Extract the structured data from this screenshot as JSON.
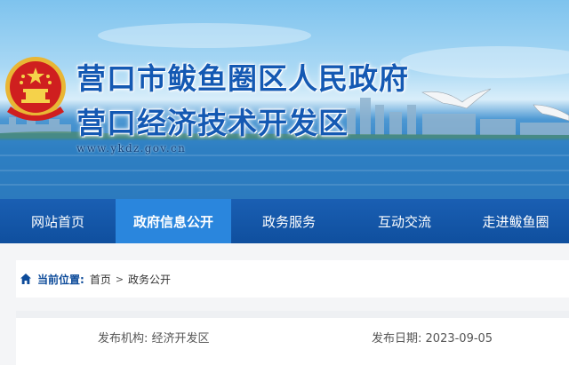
{
  "header": {
    "title_line1": "营口市鲅鱼圈区人民政府",
    "title_line2": "营口经济技术开发区",
    "url": "www.ykdz.gov.cn"
  },
  "nav": {
    "items": [
      {
        "label": "网站首页"
      },
      {
        "label": "政府信息公开"
      },
      {
        "label": "政务服务"
      },
      {
        "label": "互动交流"
      },
      {
        "label": "走进鲅鱼圈"
      }
    ],
    "active_index": 1
  },
  "breadcrumb": {
    "prefix": "当前位置:",
    "items": [
      "首页",
      "政务公开"
    ],
    "separator": ">"
  },
  "article_meta": {
    "publisher_label": "发布机构:",
    "publisher": "经济开发区",
    "date_label": "发布日期:",
    "date": "2023-09-05"
  },
  "icons": {
    "breadcrumb": "home-icon",
    "emblem": "national-emblem-icon"
  },
  "colors": {
    "title": "#1459b3",
    "nav_bg": "#0f4f9e",
    "nav_active": "#2a86dd",
    "crumb_label": "#0d4b9a"
  }
}
